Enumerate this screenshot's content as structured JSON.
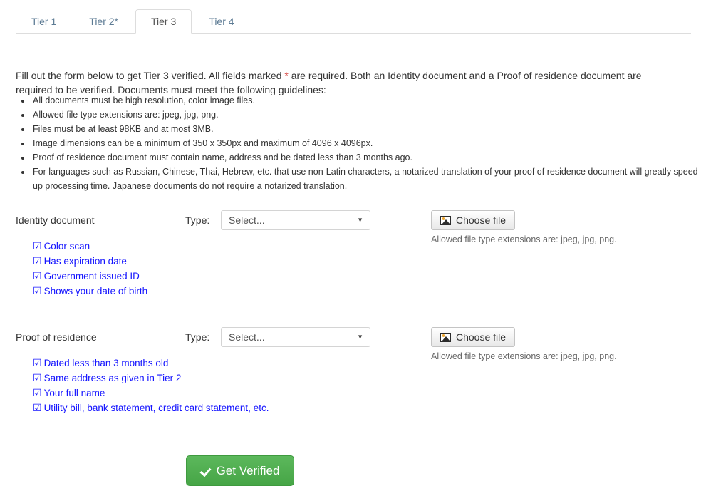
{
  "tabs": {
    "items": [
      {
        "label": "Tier 1",
        "active": false
      },
      {
        "label": "Tier 2*",
        "active": false
      },
      {
        "label": "Tier 3",
        "active": true
      },
      {
        "label": "Tier 4",
        "active": false
      }
    ]
  },
  "intro": {
    "part1": "Fill out the form below to get Tier 3 verified. All fields marked ",
    "star": "*",
    "part2": " are required. Both an Identity document and a Proof of residence document are required to be verified. Documents must meet the following guidelines:"
  },
  "guidelines": [
    "All documents must be high resolution, color image files.",
    "Allowed file type extensions are: jpeg, jpg, png.",
    "Files must be at least 98KB and at most 3MB.",
    "Image dimensions can be a minimum of 350 x 350px and maximum of 4096 x 4096px.",
    "Proof of residence document must contain name, address and be dated less than 3 months ago.",
    "For languages such as Russian, Chinese, Thai, Hebrew, etc. that use non-Latin characters, a notarized translation of your proof of residence document will greatly speed up processing time. Japanese documents do not require a notarized translation."
  ],
  "identity": {
    "label": "Identity document",
    "type_label": "Type:",
    "select_value": "Select...",
    "select_arrow": "▼",
    "choose_file_label": "Choose file",
    "choose_file_icon": "picture-icon",
    "file_help": "Allowed file type extensions are: jpeg, jpg, png.",
    "checks": [
      "Color scan",
      "Has expiration date",
      "Government issued ID",
      "Shows your date of birth"
    ],
    "check_glyph": "☑"
  },
  "residence": {
    "label": "Proof of residence",
    "type_label": "Type:",
    "select_value": "Select...",
    "select_arrow": "▼",
    "choose_file_label": "Choose file",
    "choose_file_icon": "picture-icon",
    "file_help": "Allowed file type extensions are: jpeg, jpg, png.",
    "checks": [
      "Dated less than 3 months old",
      "Same address as given in Tier 2",
      "Your full name",
      "Utility bill, bank statement, credit card statement, etc."
    ],
    "check_glyph": "☑"
  },
  "submit": {
    "label": "Get Verified",
    "icon": "check-icon"
  },
  "colors": {
    "accent_green": "#5cb85c",
    "required_star": "#d9534f",
    "check_blue": "#1414ff",
    "tab_inactive": "#5d7b94",
    "border": "#dddddd"
  }
}
